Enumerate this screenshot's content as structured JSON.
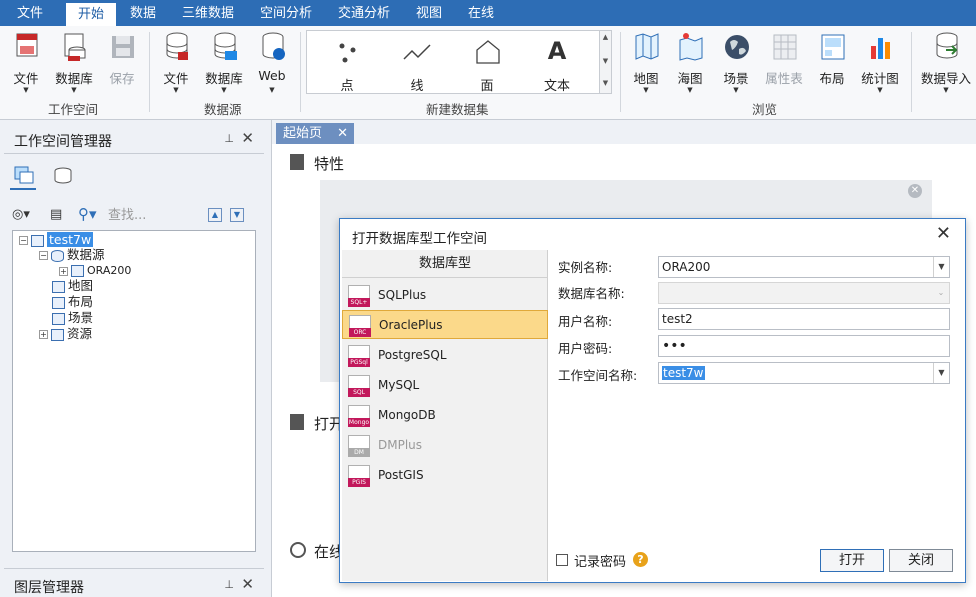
{
  "menu": {
    "items": [
      "文件",
      "开始",
      "数据",
      "三维数据",
      "空间分析",
      "交通分析",
      "视图",
      "在线"
    ],
    "active": "开始"
  },
  "ribbon": {
    "workspace": {
      "label": "工作空间",
      "buttons": [
        "文件",
        "数据库",
        "保存"
      ]
    },
    "datasource": {
      "label": "数据源",
      "buttons": [
        "文件",
        "数据库",
        "Web"
      ]
    },
    "new_dataset": {
      "label": "新建数据集",
      "items": [
        "点",
        "线",
        "面",
        "文本"
      ]
    },
    "browse": {
      "label": "浏览",
      "buttons": [
        "地图",
        "海图",
        "场景",
        "属性表",
        "布局",
        "统计图"
      ]
    },
    "import": {
      "button": "数据导入"
    }
  },
  "workspace_manager": {
    "title": "工作空间管理器",
    "search_placeholder": "查找...",
    "tree": {
      "root": "test7w",
      "datasources": "数据源",
      "datasource_item": "ORA200",
      "maps": "地图",
      "layouts": "布局",
      "scenes": "场景",
      "resources": "资源"
    }
  },
  "layer_manager": {
    "title": "图层管理器"
  },
  "doc": {
    "tab": "起始页",
    "properties_title": "特性",
    "open_title": "打开",
    "online_title": "在线"
  },
  "dialog": {
    "title": "打开数据库型工作空间",
    "db_header": "数据库型",
    "db_types": [
      {
        "name": "SQLPlus",
        "tag": "SQL+",
        "selected": false,
        "disabled": false
      },
      {
        "name": "OraclePlus",
        "tag": "ORC",
        "selected": true,
        "disabled": false
      },
      {
        "name": "PostgreSQL",
        "tag": "PGSql",
        "selected": false,
        "disabled": false
      },
      {
        "name": "MySQL",
        "tag": "SQL",
        "selected": false,
        "disabled": false
      },
      {
        "name": "MongoDB",
        "tag": "Mongo",
        "selected": false,
        "disabled": false
      },
      {
        "name": "DMPlus",
        "tag": "DM",
        "selected": false,
        "disabled": true
      },
      {
        "name": "PostGIS",
        "tag": "PGIS",
        "selected": false,
        "disabled": false
      }
    ],
    "form": {
      "instance_label": "实例名称:",
      "instance_value": "ORA200",
      "dbname_label": "数据库名称:",
      "dbname_value": "",
      "user_label": "用户名称:",
      "user_value": "test2",
      "password_label": "用户密码:",
      "password_value": "•••",
      "workspace_label": "工作空间名称:",
      "workspace_value": "test7w"
    },
    "remember_password": "记录密码",
    "help": "?",
    "open_button": "打开",
    "close_button": "关闭"
  }
}
